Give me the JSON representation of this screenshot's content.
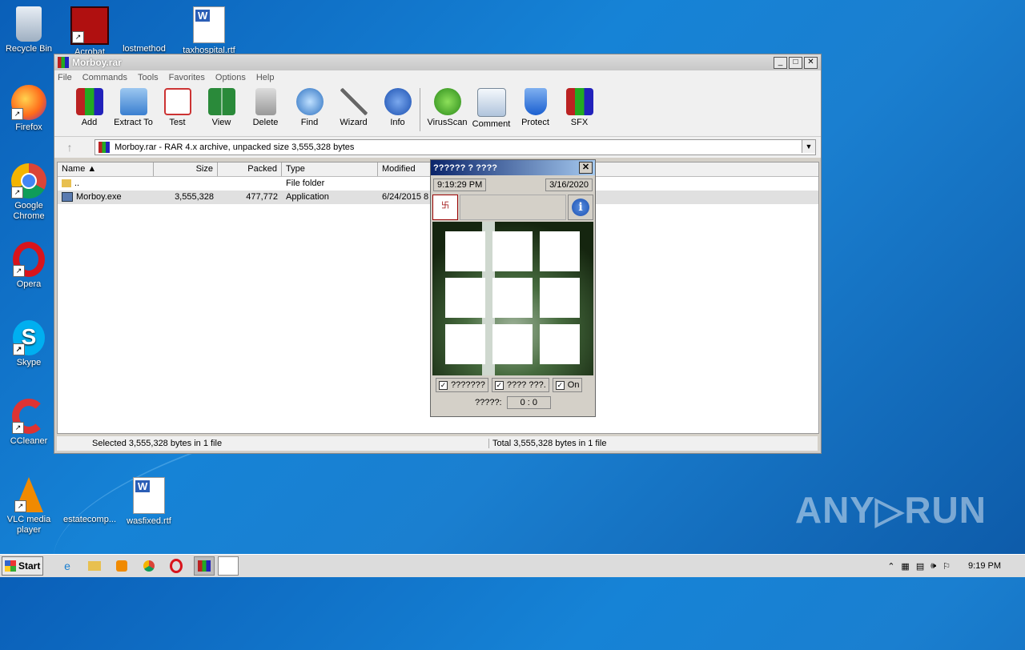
{
  "desktop": {
    "icons": [
      {
        "label": "Recycle Bin"
      },
      {
        "label": "Acrobat"
      },
      {
        "label": "lostmethod"
      },
      {
        "label": "taxhospital.rtf"
      },
      {
        "label": "Firefox"
      },
      {
        "label": "Google Chrome"
      },
      {
        "label": "Opera"
      },
      {
        "label": "Skype"
      },
      {
        "label": "CCleaner"
      },
      {
        "label": "VLC media player"
      },
      {
        "label": "estatecomp..."
      },
      {
        "label": "wasfixed.rtf"
      }
    ]
  },
  "winrar": {
    "title": "Morboy.rar",
    "menu": [
      "File",
      "Commands",
      "Tools",
      "Favorites",
      "Options",
      "Help"
    ],
    "toolbar": [
      "Add",
      "Extract To",
      "Test",
      "View",
      "Delete",
      "Find",
      "Wizard",
      "Info",
      "VirusScan",
      "Comment",
      "Protect",
      "SFX"
    ],
    "address": "Morboy.rar - RAR 4.x archive, unpacked size 3,555,328 bytes",
    "columns": [
      "Name",
      "Size",
      "Packed",
      "Type",
      "Modified"
    ],
    "rows": [
      {
        "name": "..",
        "size": "",
        "packed": "",
        "type": "File folder",
        "modified": ""
      },
      {
        "name": "Morboy.exe",
        "size": "3,555,328",
        "packed": "477,772",
        "type": "Application",
        "modified": "6/24/2015 8"
      }
    ],
    "status_left": "Selected 3,555,328 bytes in 1 file",
    "status_right": "Total 3,555,328 bytes in 1 file"
  },
  "popup": {
    "title": "?????? ? ????",
    "time": "9:19:29 PM",
    "date": "3/16/2020",
    "logo_text": "卐",
    "check1": "???????",
    "check2": "???? ???.",
    "check3": "On",
    "score_label": "?????:",
    "score_value": "0 : 0"
  },
  "taskbar": {
    "start": "Start",
    "clock": "9:19 PM"
  },
  "watermark": "ANY▷RUN"
}
